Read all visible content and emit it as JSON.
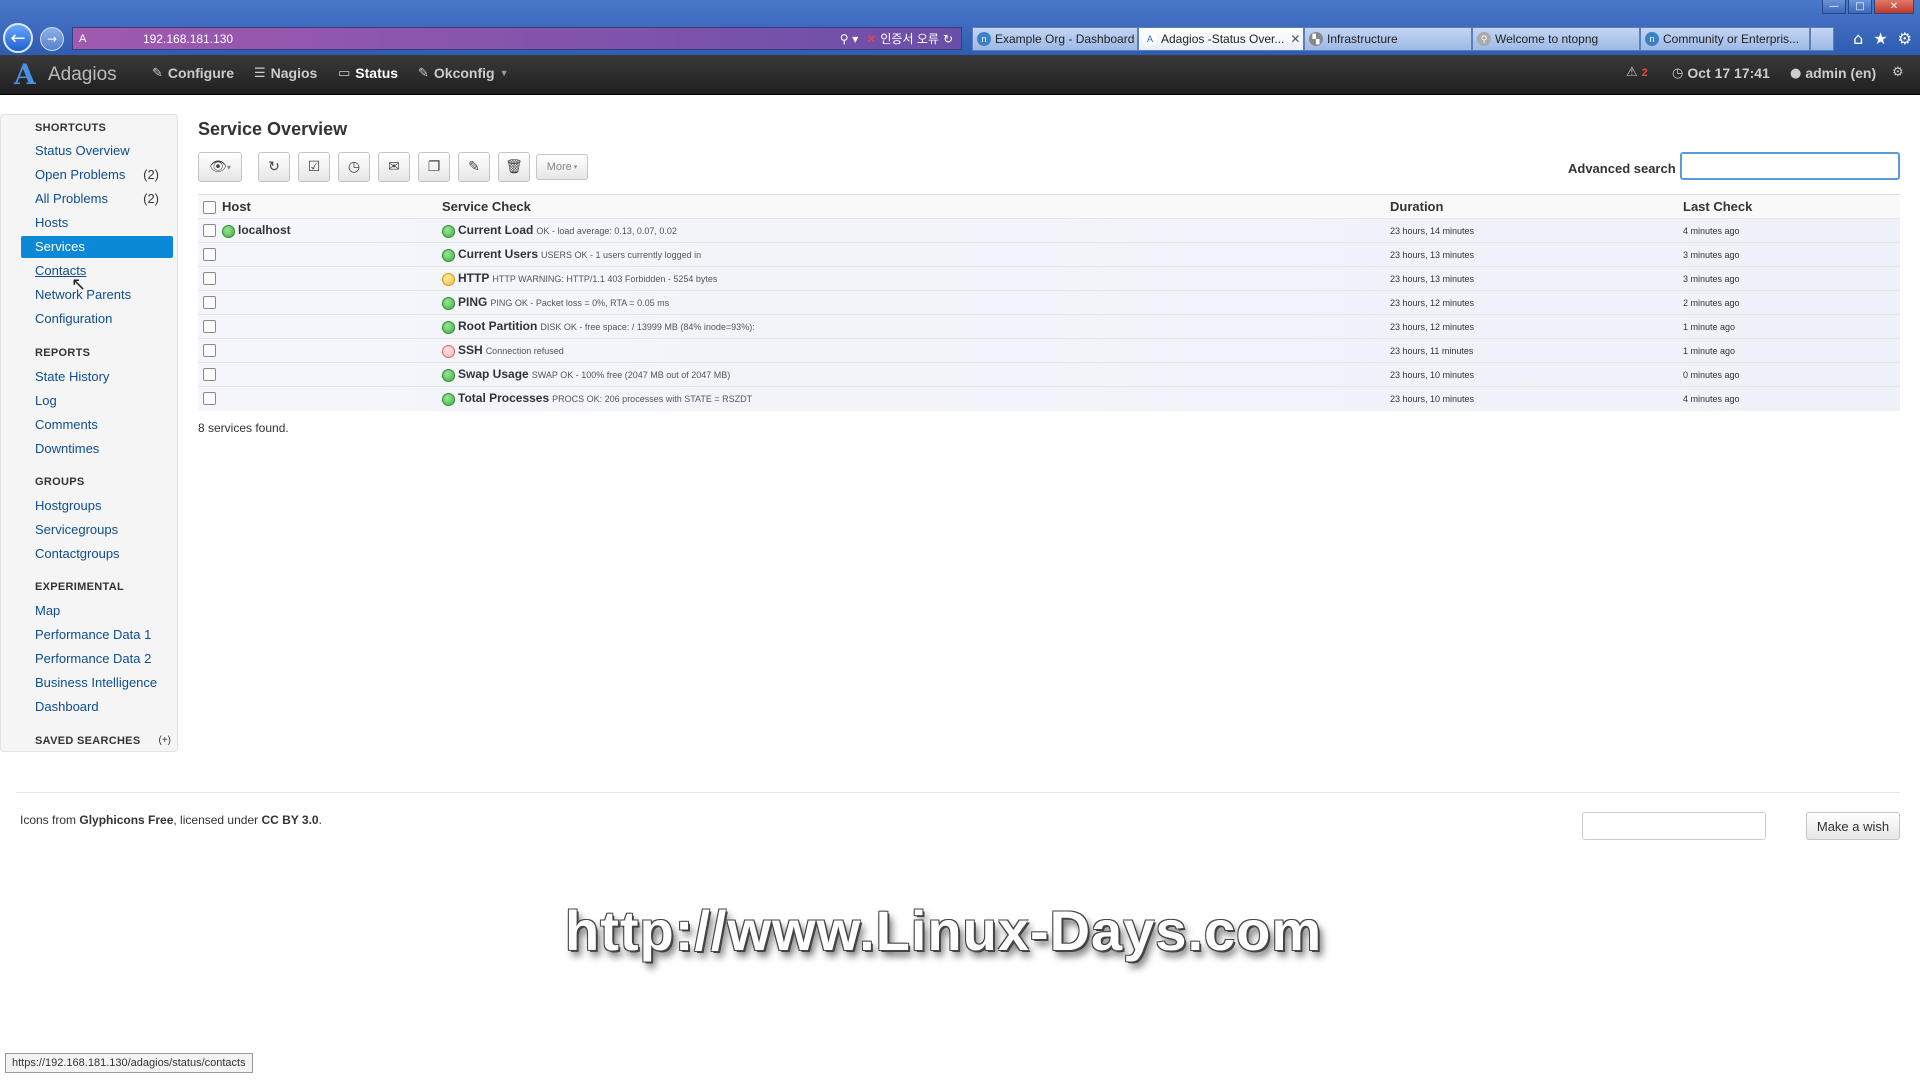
{
  "window": {
    "minimize": "—",
    "maximize": "□",
    "close": "✕"
  },
  "browser": {
    "back_icon": "←",
    "forward_icon": "→",
    "url": "192.168.181.130",
    "cert_error": "인증서 오류",
    "tabs": [
      {
        "label": "Example Org - Dashboard",
        "icon": "ntop"
      },
      {
        "label": "Adagios -Status Over...",
        "icon": "A"
      },
      {
        "label": "Infrastructure",
        "icon": "chart"
      },
      {
        "label": "Welcome to ntopng",
        "icon": "search"
      },
      {
        "label": "Community or Enterpris...",
        "icon": "ntop"
      }
    ],
    "status_bar_url": "https://192.168.181.130/adagios/status/contacts"
  },
  "navbar": {
    "brand": "Adagios",
    "links": {
      "configure": "Configure",
      "nagios": "Nagios",
      "status": "Status",
      "okconfig": "Okconfig"
    },
    "problems_count": "2",
    "datetime": "Oct 17 17:41",
    "user": "admin (en)"
  },
  "sidebar": {
    "shortcuts_header": "SHORTCUTS",
    "shortcuts": [
      {
        "label": "Status Overview",
        "count": ""
      },
      {
        "label": "Open Problems",
        "count": "(2)"
      },
      {
        "label": "All Problems",
        "count": "(2)"
      },
      {
        "label": "Hosts",
        "count": ""
      },
      {
        "label": "Services",
        "count": ""
      },
      {
        "label": "Contacts",
        "count": ""
      },
      {
        "label": "Network Parents",
        "count": ""
      },
      {
        "label": "Configuration",
        "count": ""
      }
    ],
    "reports_header": "REPORTS",
    "reports": [
      "State History",
      "Log",
      "Comments",
      "Downtimes"
    ],
    "groups_header": "GROUPS",
    "groups": [
      "Hostgroups",
      "Servicegroups",
      "Contactgroups"
    ],
    "experimental_header": "EXPERIMENTAL",
    "experimental": [
      "Map",
      "Performance Data 1",
      "Performance Data 2",
      "Business Intelligence",
      "Dashboard"
    ],
    "saved_searches_header": "SAVED SEARCHES",
    "saved_searches_add": "(+)"
  },
  "main": {
    "title": "Service Overview",
    "toolbar": {
      "more_label": "More",
      "advanced_search_label": "Advanced search",
      "advanced_search_value": ""
    },
    "table": {
      "headers": {
        "host": "Host",
        "service": "Service Check",
        "duration": "Duration",
        "last_check": "Last Check"
      },
      "rows": [
        {
          "host": "localhost",
          "host_status": "ok",
          "status": "ok",
          "service": "Current Load",
          "output": "OK - load average: 0.13, 0.07, 0.02",
          "duration": "23 hours, 14 minutes",
          "last_check": "4 minutes ago"
        },
        {
          "host": "",
          "host_status": "",
          "status": "ok",
          "service": "Current Users",
          "output": "USERS OK - 1 users currently logged in",
          "duration": "23 hours, 13 minutes",
          "last_check": "3 minutes ago"
        },
        {
          "host": "",
          "host_status": "",
          "status": "warn",
          "service": "HTTP",
          "output": "HTTP WARNING: HTTP/1.1 403 Forbidden - 5254 bytes",
          "duration": "23 hours, 13 minutes",
          "last_check": "3 minutes ago"
        },
        {
          "host": "",
          "host_status": "",
          "status": "ok",
          "service": "PING",
          "output": "PING OK - Packet loss = 0%, RTA = 0.05 ms",
          "duration": "23 hours, 12 minutes",
          "last_check": "2 minutes ago"
        },
        {
          "host": "",
          "host_status": "",
          "status": "ok",
          "service": "Root Partition",
          "output": "DISK OK - free space: / 13999 MB (84% inode=93%):",
          "duration": "23 hours, 12 minutes",
          "last_check": "1 minute ago"
        },
        {
          "host": "",
          "host_status": "",
          "status": "crit",
          "service": "SSH",
          "output": "Connection refused",
          "duration": "23 hours, 11 minutes",
          "last_check": "1 minute ago"
        },
        {
          "host": "",
          "host_status": "",
          "status": "ok",
          "service": "Swap Usage",
          "output": "SWAP OK - 100% free (2047 MB out of 2047 MB)",
          "duration": "23 hours, 10 minutes",
          "last_check": "0 minutes ago"
        },
        {
          "host": "",
          "host_status": "",
          "status": "ok",
          "service": "Total Processes",
          "output": "PROCS OK: 206 processes with STATE = RSZDT",
          "duration": "23 hours, 10 minutes",
          "last_check": "4 minutes ago"
        }
      ]
    },
    "count_text": "8 services found."
  },
  "footer": {
    "credit_prefix": "Icons from ",
    "credit_name": "Glyphicons Free",
    "credit_mid": ", licensed under ",
    "credit_license": "CC BY 3.0",
    "credit_suffix": ".",
    "wish_button": "Make a wish"
  },
  "watermark": "http://www.Linux-Days.com",
  "colors": {
    "accent": "#0b88d6",
    "navbar": "#1f1f1f",
    "ok": "#3fae3f",
    "warning": "#f0c23a",
    "critical": "#f7b5b5"
  }
}
